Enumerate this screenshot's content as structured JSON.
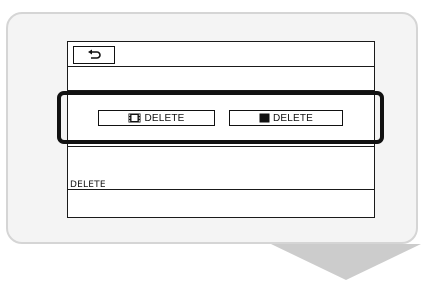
{
  "screen": {
    "back_button_icon": "return-arrow-icon",
    "options": {
      "movie_delete_label": "DELETE",
      "movie_icon": "film-icon",
      "photo_delete_label": "DELETE",
      "photo_icon": "photo-icon"
    },
    "footer_label": "DELETE"
  },
  "colors": {
    "highlight_frame": "#111111",
    "callout_background": "#f4f4f4",
    "callout_border": "#d5d5d5",
    "pointer": "#cccccc"
  }
}
